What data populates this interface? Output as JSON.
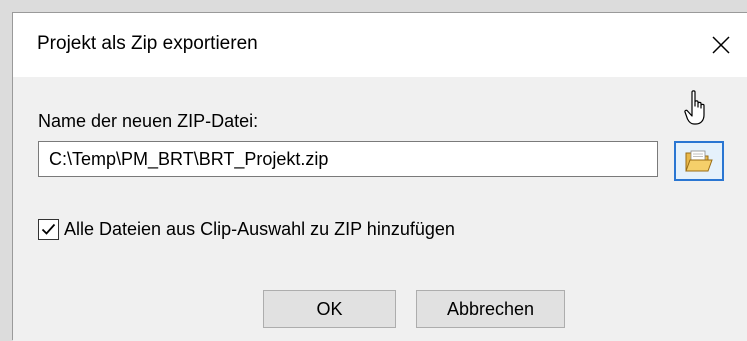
{
  "dialog": {
    "title": "Projekt als Zip exportieren",
    "close_icon": "close-icon"
  },
  "form": {
    "name_label": "Name der neuen ZIP-Datei:",
    "path_value": "C:\\Temp\\PM_BRT\\BRT_Projekt.zip",
    "browse_icon": "folder-open-icon",
    "checkbox_checked": true,
    "checkbox_label": "Alle Dateien aus Clip-Auswahl zu ZIP hinzufügen"
  },
  "buttons": {
    "ok_label": "OK",
    "cancel_label": "Abbrechen"
  },
  "colors": {
    "focus_accent": "#2a76d2",
    "dialog_background": "#f0f0f0",
    "title_background": "#ffffff"
  }
}
